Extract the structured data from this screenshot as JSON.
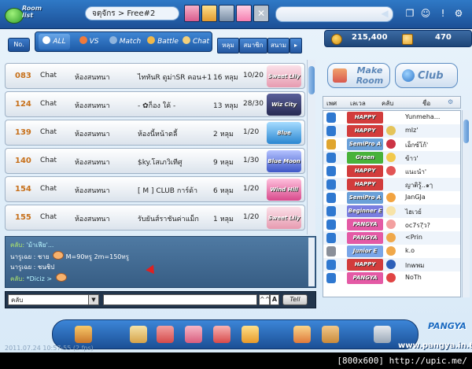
{
  "topbar": {
    "logo_text": "Room list",
    "room_title": "จตุจักร > Free#2"
  },
  "tabbar": {
    "no_label": "No.",
    "tabs": [
      {
        "label": "ALL"
      },
      {
        "label": "VS"
      },
      {
        "label": "Match"
      },
      {
        "label": "Battle"
      },
      {
        "label": "Chat"
      }
    ],
    "sort_tabs": [
      {
        "label": "หลุม"
      },
      {
        "label": "สมาชิก"
      },
      {
        "label": "สนาม"
      }
    ]
  },
  "currency": {
    "pang": "215,400",
    "cookie": "470"
  },
  "rooms": [
    {
      "num": "083",
      "mode": "Chat",
      "category": "ห้องสนทนา",
      "name": "ไททันR ดูม่าSR คอน+1",
      "holes": "16 หลุม",
      "count": "10/20",
      "course": "Sweet Lily",
      "color": "#e79ab0"
    },
    {
      "num": "124",
      "mode": "Chat",
      "category": "ห้องสนทนา",
      "name": "- ✿ก็อง ใค้ -",
      "holes": "13 หลุม",
      "count": "28/30",
      "course": "Wiz City",
      "color": "#3a3d6e"
    },
    {
      "num": "139",
      "mode": "Chat",
      "category": "ห้องสนทนา",
      "name": "ห้องนี้หน้าตลี้",
      "holes": "2 หลุม",
      "count": "1/20",
      "course": "Blue Lagoon",
      "color": "#3b9de0"
    },
    {
      "num": "140",
      "mode": "Chat",
      "category": "ห้องสนทนา",
      "name": "$ky.โสเภวิเทีศู",
      "holes": "9 หลุม",
      "count": "1/30",
      "course": "Blue Moon",
      "color": "#4b6ed6"
    },
    {
      "num": "154",
      "mode": "Chat",
      "category": "ห้องสนทนา",
      "name": "[ M ] CLUB การ์ด้า",
      "holes": "6 หลุม",
      "count": "1/20",
      "course": "Wind Hill",
      "color": "#e05a9a"
    },
    {
      "num": "155",
      "mode": "Chat",
      "category": "ห้องสนทนา",
      "name": "รับยันส์ราชันค่าแม็ก",
      "holes": "1 หลุม",
      "count": "1/20",
      "course": "Sweet Lily",
      "color": "#e79ab0"
    }
  ],
  "chat": {
    "messages": [
      {
        "prefix": "คลับ:",
        "text": "'ม้าเฟีย'...",
        "kind": "sys"
      },
      {
        "prefix": "นารูเฉย : ชาย",
        "text": "M=90ทรู 2m=150ทรู",
        "kind": "normal"
      },
      {
        "prefix": "นารูเฉย : ชนชิป",
        "text": "",
        "kind": "normal"
      },
      {
        "prefix": "คลับ:",
        "text": "*Diciz >",
        "kind": "sys"
      }
    ],
    "channel": "คลับ",
    "font_btn": "^^",
    "bold_btn": "A",
    "tell_btn": "Tell"
  },
  "right": {
    "make_room": "Make Room",
    "club": "Club",
    "headers": [
      "เพศ",
      "เลเวล",
      "คลับ",
      "ชื่อ"
    ],
    "players": [
      {
        "level": "HAPPY BIRTHDAY",
        "name": "Yunmeha...",
        "color": "#d23c3c"
      },
      {
        "level": "HAPPY BIRTHDAY",
        "name": "mIz'",
        "color": "#d23c3c"
      },
      {
        "level": "SemiPro A",
        "name": "เอ็กซ์โก้'",
        "color": "#6aa0d8"
      },
      {
        "level": "Green",
        "name": "ข้าว'",
        "color": "#48b23a"
      },
      {
        "level": "HAPPY BIRTHDAY",
        "name": "แนะนำ'",
        "color": "#d23c3c"
      },
      {
        "level": "HAPPY BIRTHDAY",
        "name": "ญาติรู้..๑ๅ",
        "color": "#d23c3c"
      },
      {
        "level": "SemiPro A",
        "name": "JanGJa",
        "color": "#6aa0d8"
      },
      {
        "level": "Beginner E",
        "name": "ไฮเวย์",
        "color": "#7a7ee0"
      },
      {
        "level": "PANGYA",
        "name": "oc7ร7ฺว?",
        "color": "#e45aa5"
      },
      {
        "level": "PANGYA",
        "name": "<Prin",
        "color": "#e45aa5"
      },
      {
        "level": "Junior E",
        "name": "k.o",
        "color": "#7aa6e8"
      },
      {
        "level": "HAPPY BIRTHDAY",
        "name": "lnwพม",
        "color": "#d23c3c"
      },
      {
        "level": "PANGYA",
        "name": "NoTh",
        "color": "#e45aa5"
      }
    ]
  },
  "bottom": {
    "pangya_logo": "PANGYA",
    "website": "www.pangya.in.th",
    "timestamp": "2011.07.24 10:57:55 (2 fps)"
  },
  "footer": {
    "text": "[800x600] http://upic.me/"
  }
}
